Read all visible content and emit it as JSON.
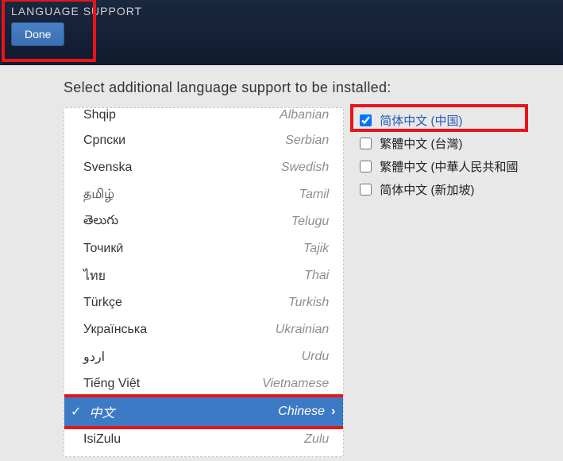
{
  "header": {
    "title": "LANGUAGE SUPPORT",
    "done_label": "Done"
  },
  "instruction": "Select additional language support to be installed:",
  "languages": [
    {
      "native": "Shqip",
      "english": "Albanian",
      "top_clipped": true
    },
    {
      "native": "Српски",
      "english": "Serbian"
    },
    {
      "native": "Svenska",
      "english": "Swedish"
    },
    {
      "native": "தமிழ்",
      "english": "Tamil"
    },
    {
      "native": "తెలుగు",
      "english": "Telugu"
    },
    {
      "native": "Точикӣ",
      "english": "Tajik"
    },
    {
      "native": "ไทย",
      "english": "Thai"
    },
    {
      "native": "Türkçe",
      "english": "Turkish"
    },
    {
      "native": "Українська",
      "english": "Ukrainian"
    },
    {
      "native": "اردو",
      "english": "Urdu"
    },
    {
      "native": "Tiếng Việt",
      "english": "Vietnamese"
    },
    {
      "native": "中文",
      "english": "Chinese",
      "selected": true
    },
    {
      "native": "IsiZulu",
      "english": "Zulu"
    }
  ],
  "locales": [
    {
      "label": "简体中文 (中国)",
      "checked": true,
      "highlighted": true
    },
    {
      "label": "繁體中文 (台灣)",
      "checked": false
    },
    {
      "label": "繁體中文 (中華人民共和國",
      "checked": false
    },
    {
      "label": "简体中文 (新加坡)",
      "checked": false
    }
  ]
}
